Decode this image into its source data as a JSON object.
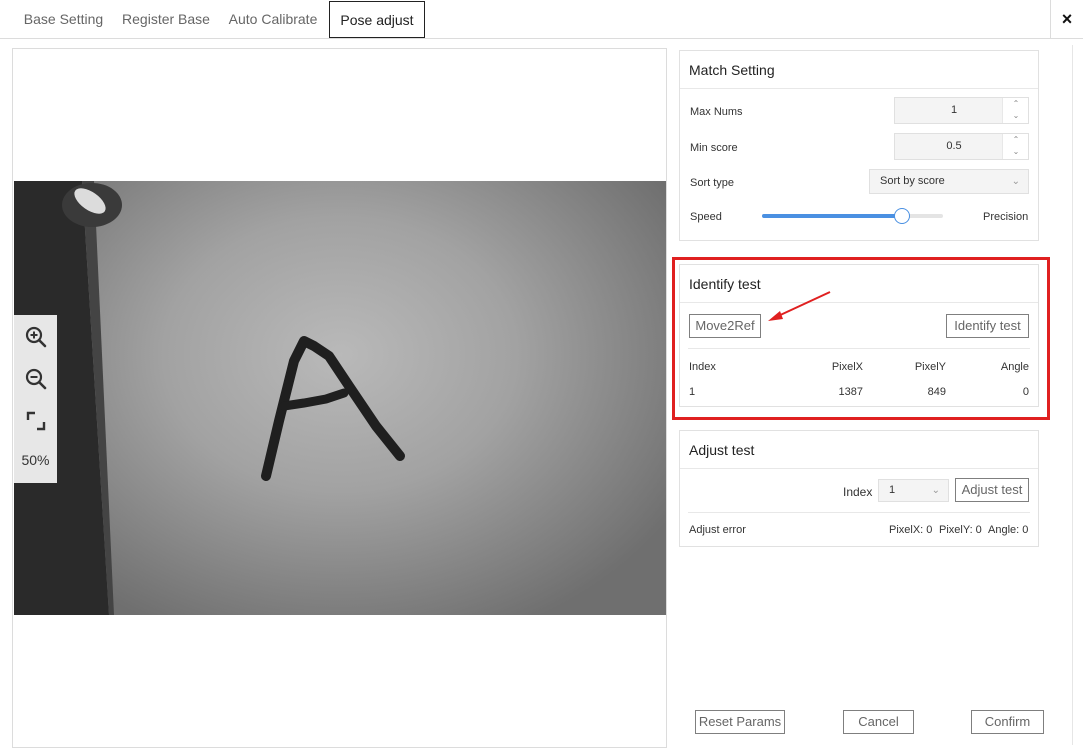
{
  "tabs": [
    "Base Setting",
    "Register Base",
    "Auto Calibrate",
    "Pose adjust"
  ],
  "close_label": "×",
  "viewer": {
    "zoom": "50%"
  },
  "match": {
    "title": "Match Setting",
    "max_nums_label": "Max Nums",
    "max_nums_value": "1",
    "min_score_label": "Min score",
    "min_score_value": "0.5",
    "sort_type_label": "Sort type",
    "sort_type_value": "Sort by score",
    "speed_label": "Speed",
    "precision_label": "Precision",
    "speed_precision_fraction": 0.8
  },
  "identify": {
    "title": "Identify test",
    "move_button": "Move2Ref",
    "identify_button": "Identify test",
    "columns": [
      "Index",
      "PixelX",
      "PixelY",
      "Angle"
    ],
    "rows": [
      [
        "1",
        "1387",
        "849",
        "0"
      ]
    ]
  },
  "adjust": {
    "title": "Adjust test",
    "index_label": "Index",
    "index_value": "1",
    "adjust_button": "Adjust test",
    "error_label": "Adjust error",
    "error_pixelx": "PixelX: 0",
    "error_pixely": "PixelY: 0",
    "error_angle": "Angle: 0"
  },
  "footer": {
    "reset": "Reset Params",
    "cancel": "Cancel",
    "confirm": "Confirm"
  },
  "colors": {
    "highlight": "#e02020",
    "accent": "#4a90e2"
  },
  "icons": [
    "zoom-in-icon",
    "zoom-out-icon",
    "fit-screen-icon",
    "close-icon",
    "chevron-down-icon"
  ]
}
